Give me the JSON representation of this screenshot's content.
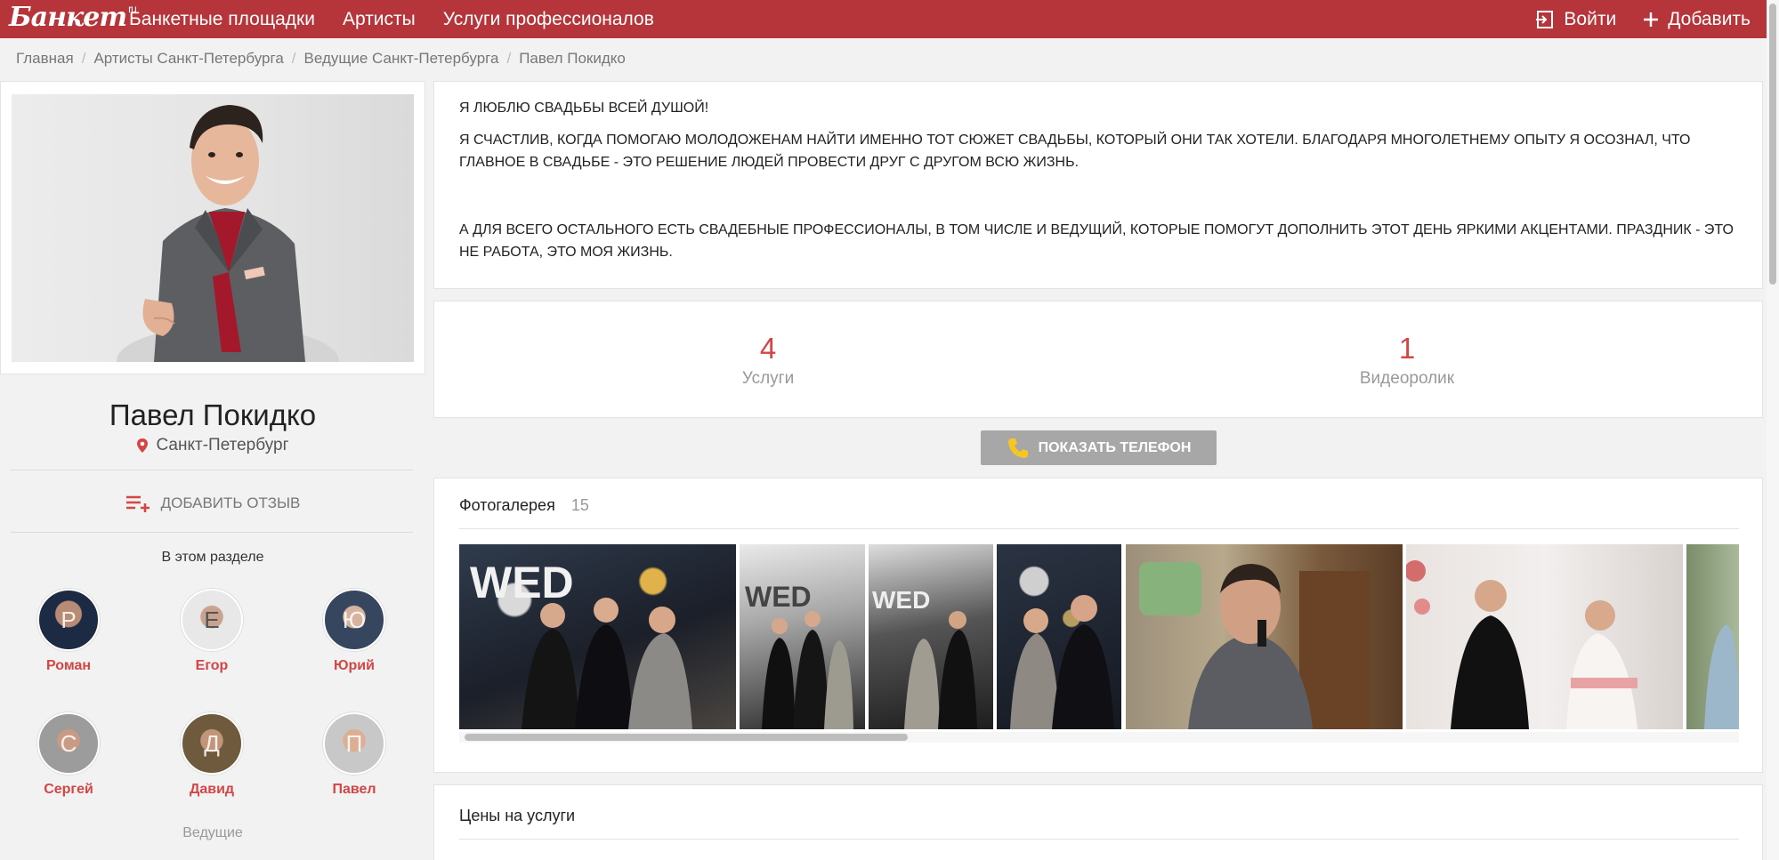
{
  "header": {
    "logo": "Банкет",
    "logo_suffix": "ru",
    "nav": [
      "Банкетные площадки",
      "Артисты",
      "Услуги профессионалов"
    ],
    "login_label": "Войти",
    "add_label": "Добавить"
  },
  "breadcrumb": [
    "Главная",
    "Артисты Санкт-Петербурга",
    "Ведущие Санкт-Петербурга",
    "Павел Покидко"
  ],
  "profile": {
    "name": "Павел Покидко",
    "city": "Санкт-Петербург",
    "add_review": "ДОБАВИТЬ ОТЗЫВ",
    "section_title": "В этом разделе",
    "people": [
      "Роман",
      "Егор",
      "Юрий",
      "Сергей",
      "Давид",
      "Павел"
    ],
    "category": "Ведущие"
  },
  "about": {
    "p1": "Я ЛЮБЛЮ СВАДЬБЫ ВСЕЙ ДУШОЙ!",
    "p2": "Я СЧАСТЛИВ, КОГДА ПОМОГАЮ МОЛОДОЖЕНАМ НАЙТИ ИМЕННО ТОТ СЮЖЕТ СВАДЬБЫ, КОТОРЫЙ ОНИ ТАК ХОТЕЛИ. БЛАГОДАРЯ МНОГОЛЕТНЕМУ ОПЫТУ Я ОСОЗНАЛ, ЧТО ГЛАВНОЕ В СВАДЬБЕ - ЭТО РЕШЕНИЕ ЛЮДЕЙ ПРОВЕСТИ ДРУГ С ДРУГОМ ВСЮ ЖИЗНЬ.",
    "p3": "А ДЛЯ ВСЕГО ОСТАЛЬНОГО ЕСТЬ СВАДЕБНЫЕ ПРОФЕССИОНАЛЫ, В ТОМ ЧИСЛЕ И ВЕДУЩИЙ, КОТОРЫЕ ПОМОГУТ ДОПОЛНИТЬ ЭТОТ ДЕНЬ ЯРКИМИ АКЦЕНТАМИ. ПРАЗДНИК - ЭТО НЕ РАБОТА, ЭТО МОЯ ЖИЗНЬ."
  },
  "stats": {
    "services_count": "4",
    "services_label": "Услуги",
    "videos_count": "1",
    "videos_label": "Видеоролик"
  },
  "phone_button": "ПОКАЗАТЬ ТЕЛЕФОН",
  "gallery": {
    "title": "Фотогалерея",
    "count": "15"
  },
  "prices": {
    "title": "Цены на услуги"
  },
  "colors": {
    "brand": "#b5353a",
    "accent": "#d44545",
    "button_gray": "#a7a7a7"
  }
}
